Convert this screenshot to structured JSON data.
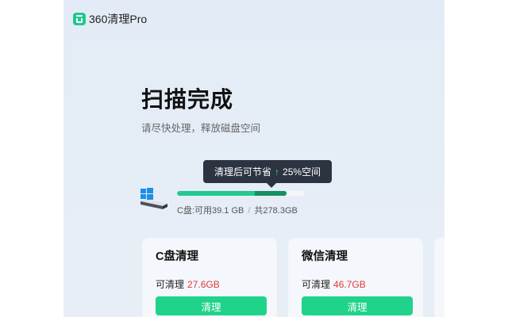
{
  "app": {
    "name": "360清理Pro",
    "icon": "broom-bin-icon",
    "accent": "#1ec98d"
  },
  "scan": {
    "title": "扫描完成",
    "subtitle": "请尽快处理，释放磁盘空间"
  },
  "tooltip": {
    "prefix": "清理后可节省",
    "arrow": "↑",
    "value": "25%空间"
  },
  "disk": {
    "icon": "windows-drive-icon",
    "info_free": "C盘:可用39.1 GB",
    "separator": "/",
    "info_total": "共278.3GB",
    "used_fraction": 0.86,
    "savable_fraction": 0.25
  },
  "cards": [
    {
      "title": "C盘清理",
      "size_label": "可清理",
      "size_value": "27.6GB",
      "button": "清理"
    },
    {
      "title": "微信清理",
      "size_label": "可清理",
      "size_value": "46.7GB",
      "button": "清理"
    }
  ],
  "colors": {
    "progress_used": "#23c98e",
    "progress_savable": "#15915f",
    "button": "#1fd38a",
    "size_value": "#e03a3a",
    "tooltip_bg": "#2c3442"
  }
}
